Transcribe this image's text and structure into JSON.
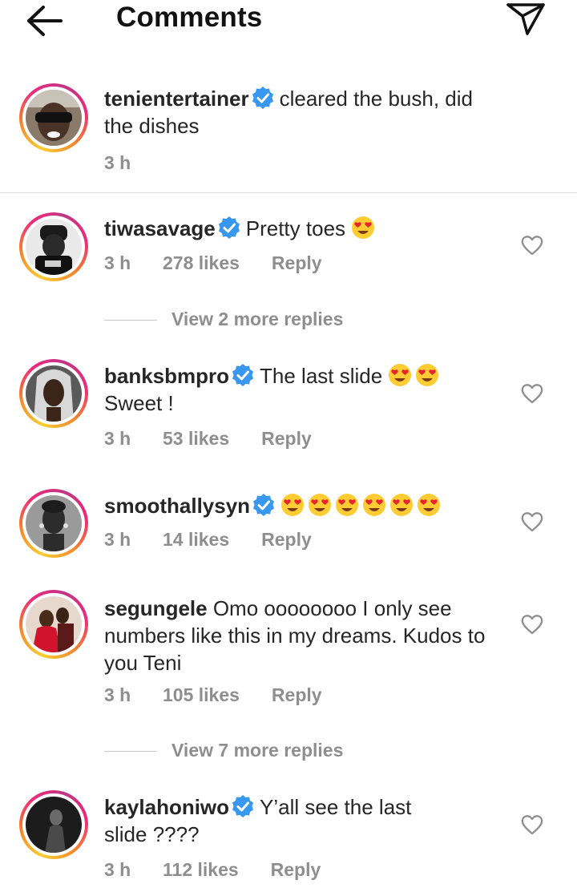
{
  "header": {
    "title": "Comments",
    "back_icon": "arrow-left-icon",
    "send_icon": "paper-plane-icon"
  },
  "caption": {
    "username": "tenientertainer",
    "verified": true,
    "text": "cleared the bush,  did the dishes",
    "time": "3 h"
  },
  "comments": [
    {
      "username": "tiwasavage",
      "verified": true,
      "text": "Pretty toes",
      "emoji_count": 1,
      "time": "3 h",
      "likes": "278 likes",
      "reply_label": "Reply",
      "view_more": "View 2 more replies"
    },
    {
      "username": "banksbmpro",
      "verified": true,
      "text": "The last slide",
      "emoji_count": 2,
      "text2": "Sweet !",
      "time": "3 h",
      "likes": "53 likes",
      "reply_label": "Reply"
    },
    {
      "username": "smoothallysyn",
      "verified": true,
      "text": "",
      "emoji_count": 6,
      "time": "3 h",
      "likes": "14 likes",
      "reply_label": "Reply"
    },
    {
      "username": "segungele",
      "verified": false,
      "text": "Omo oooooooo I only see numbers like this in my dreams. Kudos to you Teni",
      "time": "3 h",
      "likes": "105 likes",
      "reply_label": "Reply",
      "view_more": "View 7 more replies"
    },
    {
      "username": "kaylahoniwo",
      "verified": true,
      "text": "Y’all see the last slide ????",
      "time": "3 h",
      "likes": "112 likes",
      "reply_label": "Reply"
    }
  ],
  "icons": {
    "verified": "verified-badge-icon",
    "like": "heart-outline-icon",
    "emoji": "heart-eyes-emoji-icon"
  },
  "colors": {
    "verified": "#3897f0",
    "muted": "#8e8e8e",
    "text": "#262626"
  }
}
